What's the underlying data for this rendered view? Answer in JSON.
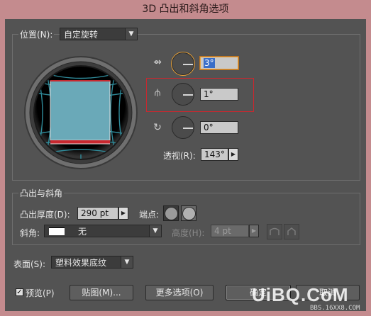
{
  "window": {
    "title": "3D 凸出和斜角选项"
  },
  "position": {
    "label": "位置(N):",
    "preset": "自定旋转",
    "rotate_x_value": "3°",
    "rotate_y_value": "1°",
    "rotate_z_value": "0°",
    "perspective_label": "透视(R):",
    "perspective_value": "143°"
  },
  "extrude": {
    "group_title": "凸出与斜角",
    "depth_label": "凸出厚度(D):",
    "depth_value": "290 pt",
    "cap_label": "端点:",
    "bevel_label": "斜角:",
    "bevel_value": "无",
    "height_label": "高度(H):",
    "height_value": "4 pt"
  },
  "surface": {
    "label": "表面(S):",
    "value": "塑料效果底纹"
  },
  "footer": {
    "preview_label": "预览(P)",
    "preview_checked": "✓",
    "map_art_label": "贴图(M)...",
    "more_options_label": "更多选项(O)",
    "ok_label": "确定",
    "cancel_label": "取消"
  },
  "watermark": {
    "logo": "UiBQ.CoM",
    "url": "BBS.16XX8.COM"
  },
  "colors": {
    "cube_face": "#6aa9b8",
    "highlight_box": "#c8282f",
    "accent_focus": "#e8a23a"
  }
}
